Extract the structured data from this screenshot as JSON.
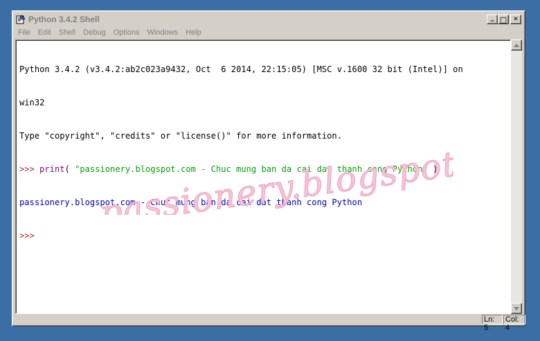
{
  "window": {
    "title": "Python 3.4.2 Shell",
    "controls": {
      "minimize": "_",
      "maximize": "□",
      "close": "✕"
    }
  },
  "menu": {
    "items": [
      "File",
      "Edit",
      "Shell",
      "Debug",
      "Options",
      "Windows",
      "Help"
    ]
  },
  "shell": {
    "banner_line1": "Python 3.4.2 (v3.4.2:ab2c023a9432, Oct  6 2014, 22:15:05) [MSC v.1600 32 bit (Intel)] on",
    "banner_line2": "win32",
    "banner_line3": "Type \"copyright\", \"credits\" or \"license()\" for more information.",
    "prompt": ">>> ",
    "cmd_keyword": "print",
    "cmd_open": "( ",
    "cmd_string": "\"passionery.blogspot.com - Chuc mung ban da cai dat thanh cong Python\"",
    "cmd_close": " )",
    "output": "passionery.blogspot.com - Chuc mung ban da cai dat thanh cong Python",
    "prompt_final": ">>>"
  },
  "watermark": {
    "text": "passionery.blogspot.com",
    "color": "#f4b6cc"
  },
  "status": {
    "line": "Ln: 5",
    "col": "Col: 4"
  },
  "colors": {
    "prompt": "#a52a2a",
    "keyword": "#800080",
    "string": "#00a000",
    "output": "#0000c0",
    "desktop": "#3a6ea5"
  }
}
